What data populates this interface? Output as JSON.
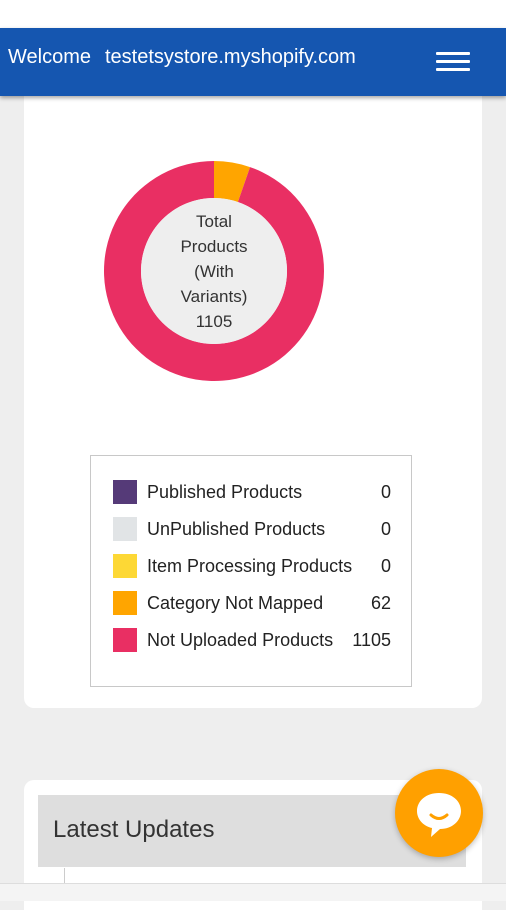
{
  "header": {
    "welcome_label": "Welcome",
    "store_name": "testetsystore.myshopify.com",
    "menu_icon": "hamburger-menu-icon",
    "background_color": "#1556b0"
  },
  "summary": {
    "center_label_lines": [
      "Total",
      "Products",
      "(With",
      "Variants)",
      "1105"
    ],
    "legend": [
      {
        "label": "Published Products",
        "value": "0",
        "color": "#553a78"
      },
      {
        "label": "UnPublished Products",
        "value": "0",
        "color": "#e1e4e6"
      },
      {
        "label": "Item Processing Products",
        "value": "0",
        "color": "#fdd835"
      },
      {
        "label": "Category Not Mapped",
        "value": "62",
        "color": "#ffa500"
      },
      {
        "label": "Not Uploaded Products",
        "value": "1105",
        "color": "#e92f63"
      }
    ]
  },
  "chart_data": {
    "type": "pie",
    "categories": [
      "Published Products",
      "UnPublished Products",
      "Item Processing Products",
      "Category Not Mapped",
      "Not Uploaded Products"
    ],
    "values": [
      0,
      0,
      0,
      62,
      1105
    ],
    "colors": [
      "#553a78",
      "#e1e4e6",
      "#fdd835",
      "#ffa500",
      "#e92f63"
    ],
    "donut": true,
    "legend": "bottom"
  },
  "updates": {
    "title": "Latest Updates"
  },
  "chat": {
    "icon": "chat-bubble-icon",
    "color": "#ffa000"
  }
}
